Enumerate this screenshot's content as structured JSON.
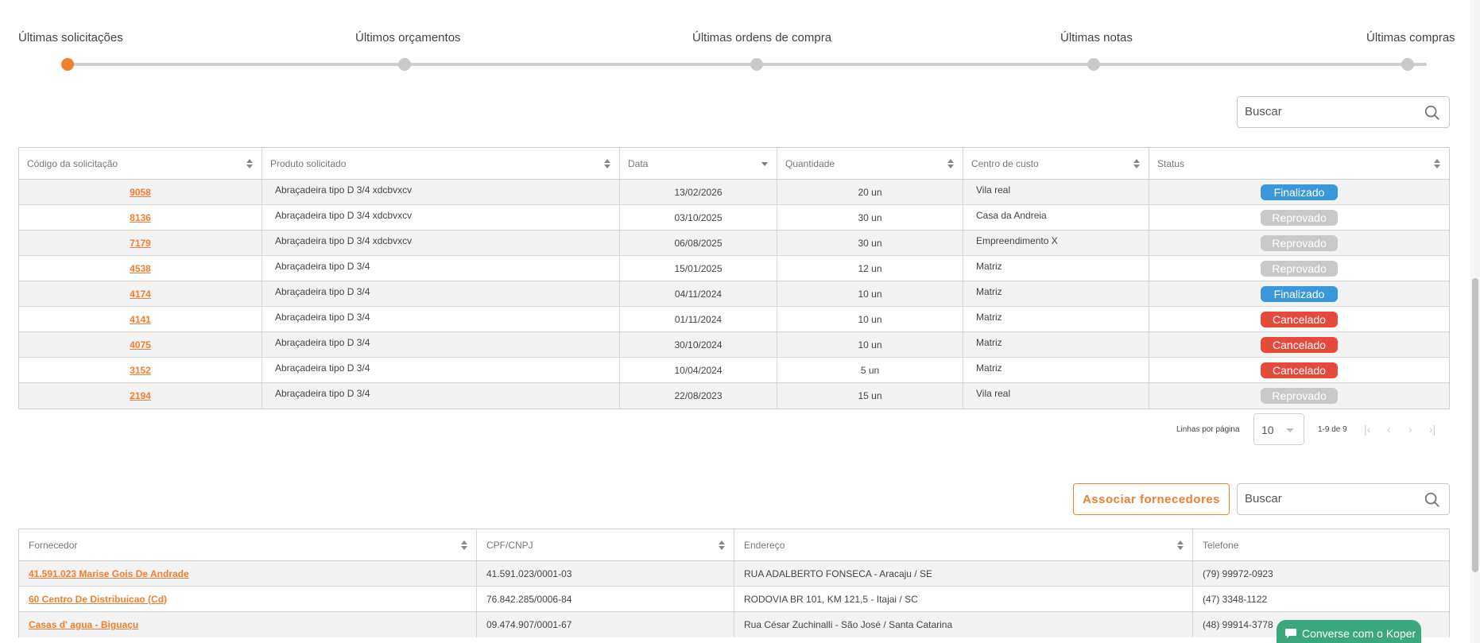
{
  "stepper": {
    "steps": [
      "Últimas solicitações",
      "Últimos orçamentos",
      "Últimas ordens de compra",
      "Últimas notas",
      "Últimas compras"
    ],
    "active_index": 0
  },
  "requests": {
    "search_placeholder": "Buscar",
    "columns": [
      "Código da solicitação",
      "Produto solicitado",
      "Data",
      "Quantidade",
      "Centro de custo",
      "Status"
    ],
    "rows": [
      {
        "code": "9058",
        "product": "Abraçadeira tipo D 3/4 xdcbvxcv",
        "date": "13/02/2026",
        "qty": "20 un",
        "cost_center": "Vila real",
        "status": "Finalizado"
      },
      {
        "code": "8136",
        "product": "Abraçadeira tipo D 3/4 xdcbvxcv",
        "date": "03/10/2025",
        "qty": "30 un",
        "cost_center": "Casa da Andreia",
        "status": "Reprovado"
      },
      {
        "code": "7179",
        "product": "Abraçadeira tipo D 3/4 xdcbvxcv",
        "date": "06/08/2025",
        "qty": "30 un",
        "cost_center": "Empreendimento X",
        "status": "Reprovado"
      },
      {
        "code": "4538",
        "product": "Abraçadeira tipo D 3/4",
        "date": "15/01/2025",
        "qty": "12 un",
        "cost_center": "Matriz",
        "status": "Reprovado"
      },
      {
        "code": "4174",
        "product": "Abraçadeira tipo D 3/4",
        "date": "04/11/2024",
        "qty": "10 un",
        "cost_center": "Matriz",
        "status": "Finalizado"
      },
      {
        "code": "4141",
        "product": "Abraçadeira tipo D 3/4",
        "date": "01/11/2024",
        "qty": "10 un",
        "cost_center": "Matriz",
        "status": "Cancelado"
      },
      {
        "code": "4075",
        "product": "Abraçadeira tipo D 3/4",
        "date": "30/10/2024",
        "qty": "10 un",
        "cost_center": "Matriz",
        "status": "Cancelado"
      },
      {
        "code": "3152",
        "product": "Abraçadeira tipo D 3/4",
        "date": "10/04/2024",
        "qty": "5 un",
        "cost_center": "Matriz",
        "status": "Cancelado"
      },
      {
        "code": "2194",
        "product": "Abraçadeira tipo D 3/4",
        "date": "22/08/2023",
        "qty": "15 un",
        "cost_center": "Vila real",
        "status": "Reprovado"
      }
    ],
    "status_colors": {
      "Finalizado": "#3a97d9",
      "Reprovado": "#c9c9c9",
      "Cancelado": "#e64a3b"
    }
  },
  "pagination": {
    "rows_per_page_label": "Linhas por página",
    "rows_per_page": "10",
    "range": "1-9 de 9"
  },
  "suppliers": {
    "associate_label": "Associar fornecedores",
    "search_placeholder": "Buscar",
    "columns": [
      "Fornecedor",
      "CPF/CNPJ",
      "Endereço",
      "Telefone"
    ],
    "rows": [
      {
        "name": "41.591.023 Marise Gois De Andrade",
        "doc": "41.591.023/0001-03",
        "address": "RUA ADALBERTO FONSECA - Aracaju / SE",
        "phone": "(79) 99972-0923"
      },
      {
        "name": "60 Centro De Distribuicao (Cd)",
        "doc": "76.842.285/0006-84",
        "address": "RODOVIA BR 101, KM 121,5 - Itajai / SC",
        "phone": "(47) 3348-1122"
      },
      {
        "name": "Casas d' agua - Biguaçu",
        "doc": "09.474.907/0001-67",
        "address": "Rua César Zuchinalli - São José / Santa Catarina",
        "phone": "(48) 99914-3778"
      }
    ]
  },
  "chat": {
    "label": "Converse com o Koper"
  },
  "colors": {
    "accent": "#f07f30",
    "chat": "#3aa87c"
  }
}
